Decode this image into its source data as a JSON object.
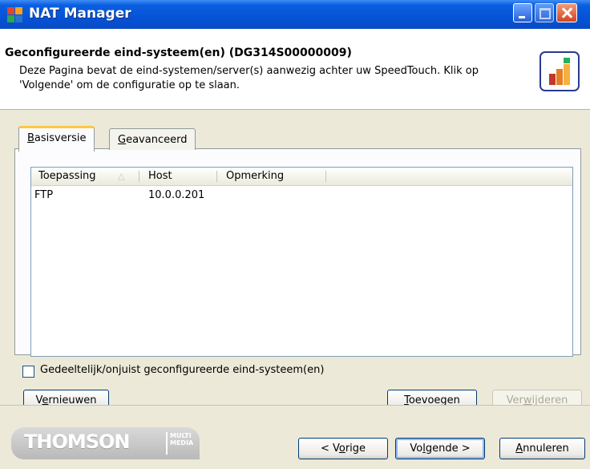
{
  "window": {
    "title": "NAT Manager"
  },
  "header": {
    "title": "Geconfigureerde eind-systeem(en) (DG314S00000009)",
    "description": "Deze Pagina bevat de eind-systemen/server(s) aanwezig achter uw SpeedTouch. Klik op 'Volgende' om de configuratie op te slaan."
  },
  "tabs": [
    {
      "label": "Basisversie",
      "mnemonic": "B",
      "rest": "asisversie",
      "active": true
    },
    {
      "label": "Geavanceerd",
      "mnemonic": "G",
      "rest": "eavanceerd",
      "active": false
    }
  ],
  "table": {
    "columns": [
      "Toepassing",
      "Host",
      "Opmerking"
    ],
    "rows": [
      {
        "Toepassing": "FTP",
        "Host": "10.0.0.201",
        "Opmerking": ""
      }
    ]
  },
  "checkbox": {
    "label": "Gedeeltelijk/onjuist geconfigureerde eind-systeem(en)",
    "checked": false
  },
  "buttons": {
    "refresh": {
      "pre": "V",
      "mn": "e",
      "post": "rnieuwen"
    },
    "add": {
      "pre": "",
      "mn": "T",
      "post": "oevoegen"
    },
    "remove": {
      "pre": "Ver",
      "mn": "w",
      "post": "ijderen"
    },
    "prev": {
      "pre": "< V",
      "mn": "o",
      "post": "rige"
    },
    "next": {
      "pre": "Vo",
      "mn": "l",
      "post": "gende >"
    },
    "cancel": {
      "pre": "",
      "mn": "A",
      "post": "nnuleren"
    }
  },
  "brand": {
    "name": "THOMSON",
    "sub1": "MULTI",
    "sub2": "MEDIA"
  },
  "colors": {
    "titlebar": "#0553d8",
    "tab_highlight": "#ffc83d",
    "dialog_bg": "#ece9d8"
  }
}
